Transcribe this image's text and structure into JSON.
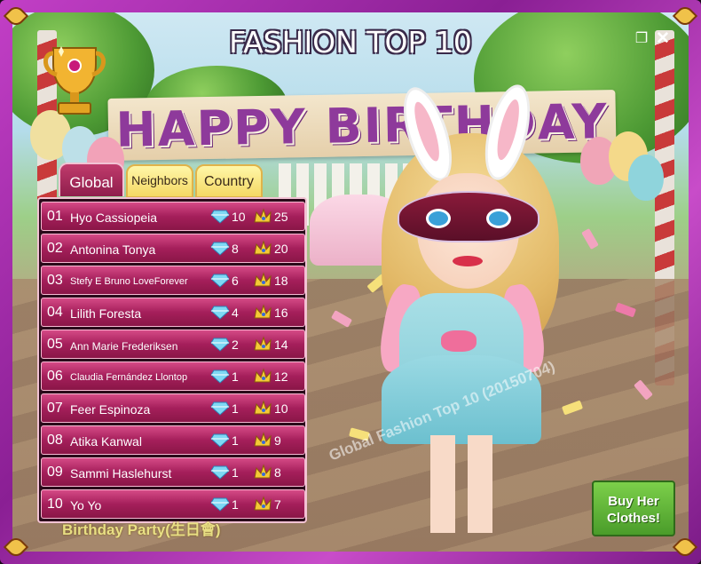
{
  "title": "FASHION TOP 10",
  "banner_text": "HAPPY BIRTHDAY",
  "window": {
    "restore_icon": "restore-window-icon",
    "close_icon": "close-icon"
  },
  "tabs": [
    {
      "label": "Global",
      "active": true
    },
    {
      "label": "Neighbors",
      "active": false
    },
    {
      "label": "Country",
      "active": false
    }
  ],
  "leaderboard": [
    {
      "rank": "01",
      "name": "Hyo Cassiopeia",
      "gems": "10",
      "crowns": "25"
    },
    {
      "rank": "02",
      "name": "Antonina Tonya",
      "gems": "8",
      "crowns": "20"
    },
    {
      "rank": "03",
      "name": "Stefy E Bruno LoveForever",
      "gems": "6",
      "crowns": "18"
    },
    {
      "rank": "04",
      "name": "Lilith Foresta",
      "gems": "4",
      "crowns": "16"
    },
    {
      "rank": "05",
      "name": "Ann Marie Frederiksen",
      "gems": "2",
      "crowns": "14"
    },
    {
      "rank": "06",
      "name": "Claudia Fernández Llontop",
      "gems": "1",
      "crowns": "12"
    },
    {
      "rank": "07",
      "name": "Feer Espinoza",
      "gems": "1",
      "crowns": "10"
    },
    {
      "rank": "08",
      "name": "Atika Kanwal",
      "gems": "1",
      "crowns": "9"
    },
    {
      "rank": "09",
      "name": "Sammi Haslehurst",
      "gems": "1",
      "crowns": "8"
    },
    {
      "rank": "10",
      "name": "Yo Yo",
      "gems": "1",
      "crowns": "7"
    }
  ],
  "watermark": "Global Fashion Top 10 (20150704)",
  "outfit_name": "Birthday Party(生日會)",
  "buy_button": {
    "line1": "Buy Her",
    "line2": "Clothes!"
  },
  "colors": {
    "frame": "#b236b8",
    "row": "#b0286a",
    "tab_active": "#a82b5e",
    "tab_inactive": "#f6e07a",
    "buy": "#5fb238"
  },
  "icons": [
    "trophy-icon",
    "diamond-icon",
    "crown-icon"
  ]
}
